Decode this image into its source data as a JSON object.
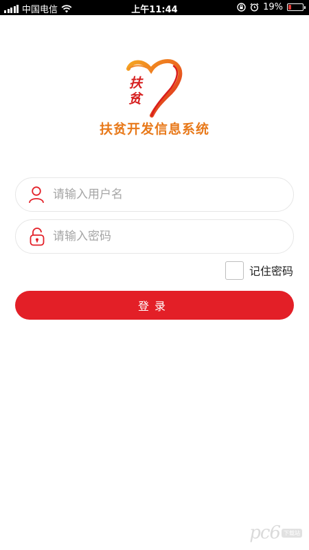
{
  "status_bar": {
    "carrier": "中国电信",
    "time": "上午11:44",
    "battery_percent": "19%",
    "battery_level": 0.19,
    "battery_color": "#e53935",
    "icons": [
      "signal-icon",
      "wifi-icon",
      "orientation-lock-icon",
      "alarm-icon",
      "battery-icon"
    ]
  },
  "logo": {
    "char1": "扶",
    "char2": "贫",
    "icon": "heart-logo-icon"
  },
  "app_title": "扶贫开发信息系统",
  "login_form": {
    "username_placeholder": "请输入用户名",
    "username_icon": "user-icon",
    "password_placeholder": "请输入密码",
    "password_icon": "lock-icon",
    "remember_label": "记住密码",
    "remember_checked": false,
    "login_label": "登录"
  },
  "watermark": {
    "text": "pc6",
    "badge": "下载站"
  },
  "colors": {
    "accent": "#e31f27",
    "title_orange": "#e8791a",
    "placeholder": "#a5a5a5",
    "input_border": "#e6e6e6"
  }
}
